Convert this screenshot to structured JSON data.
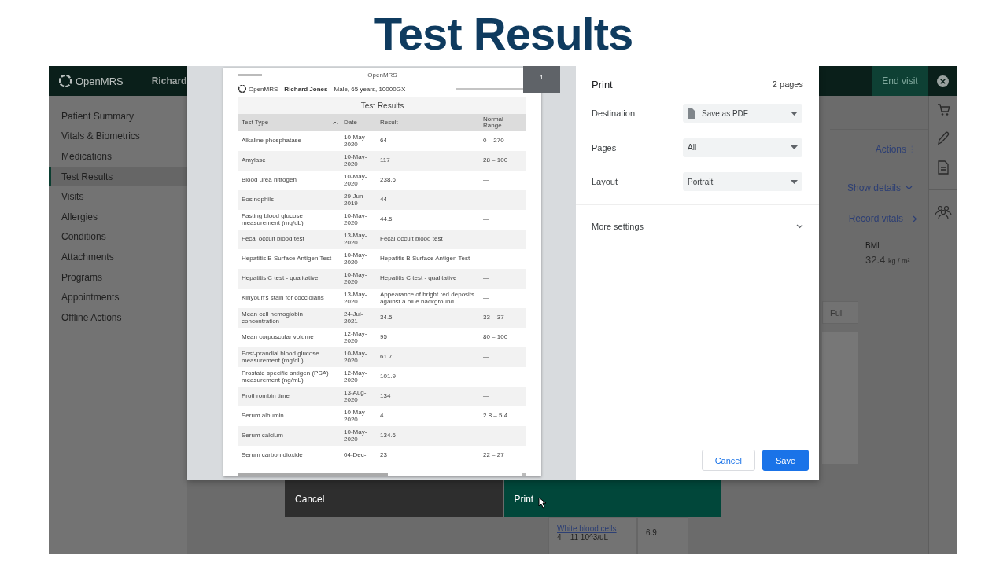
{
  "slide_title": "Test Results",
  "app": {
    "logo": "OpenMRS",
    "patient_name": "Richard",
    "end_visit": "End visit",
    "sidebar": {
      "items": [
        {
          "label": "Patient Summary",
          "selected": false
        },
        {
          "label": "Vitals & Biometrics",
          "selected": false
        },
        {
          "label": "Medications",
          "selected": false
        },
        {
          "label": "Test Results",
          "selected": true
        },
        {
          "label": "Visits",
          "selected": false
        },
        {
          "label": "Allergies",
          "selected": false
        },
        {
          "label": "Conditions",
          "selected": false
        },
        {
          "label": "Attachments",
          "selected": false
        },
        {
          "label": "Programs",
          "selected": false
        },
        {
          "label": "Appointments",
          "selected": false
        },
        {
          "label": "Offline Actions",
          "selected": false
        }
      ]
    },
    "actions": "Actions",
    "show_details": "Show details",
    "record_vitals": "Record vitals",
    "bmi": {
      "label": "BMI",
      "value": "32.4",
      "unit": "kg / m²"
    },
    "full_button": "Full",
    "result_row": {
      "test": "White blood cells",
      "range": "4 – 11 10^3/uL",
      "value": "6.9"
    },
    "modal_buttons": {
      "cancel": "Cancel",
      "print": "Print"
    }
  },
  "print_dialog": {
    "preview": {
      "page_badge": "1",
      "site": "OpenMRS",
      "logo": "OpenMRS",
      "patient_name": "Richard Jones",
      "patient_info": "Male, 65 years, 10000GX",
      "title": "Test Results",
      "columns": [
        "Test Type",
        "Date",
        "Result",
        "Normal Range"
      ],
      "rows": [
        {
          "test": "Alkaline phosphatase",
          "date": "10-May-2020",
          "result": "64",
          "range": "0 – 270"
        },
        {
          "test": "Amylase",
          "date": "10-May-2020",
          "result": "117",
          "range": "28 – 100"
        },
        {
          "test": "Blood urea nitrogen",
          "date": "10-May-2020",
          "result": "238.6",
          "range": "—"
        },
        {
          "test": "Eosinophils",
          "date": "29-Jun-2019",
          "result": "44",
          "range": "—"
        },
        {
          "test": "Fasting blood glucose measurement (mg/dL)",
          "date": "10-May-2020",
          "result": "44.5",
          "range": "—"
        },
        {
          "test": "Fecal occult blood test",
          "date": "13-May-2020",
          "result": "Fecal occult blood test"
        },
        {
          "test": "Hepatitis B Surface Antigen Test",
          "date": "10-May-2020",
          "result": "Hepatitis B Surface Antigen Test"
        },
        {
          "test": "Hepatitis C test - qualitative",
          "date": "10-May-2020",
          "result": "Hepatitis C test - qualitative",
          "range": "—"
        },
        {
          "test": "Kinyoun's stain for coccidians",
          "date": "13-May-2020",
          "result": "Appearance of bright red deposits against a blue background.",
          "range": "—"
        },
        {
          "test": "Mean cell hemoglobin concentration",
          "date": "24-Jul-2021",
          "result": "34.5",
          "range": "33 – 37"
        },
        {
          "test": "Mean corpuscular volume",
          "date": "12-May-2020",
          "result": "95",
          "range": "80 – 100"
        },
        {
          "test": "Post-prandial blood glucose measurement (mg/dL)",
          "date": "10-May-2020",
          "result": "61.7",
          "range": "—"
        },
        {
          "test": "Prostate specific antigen (PSA) measurement (ng/mL)",
          "date": "12-May-2020",
          "result": "101.9",
          "range": "—"
        },
        {
          "test": "Prothrombin time",
          "date": "13-Aug-2020",
          "result": "134",
          "range": "—"
        },
        {
          "test": "Serum albumin",
          "date": "10-May-2020",
          "result": "4",
          "range": "2.8 – 5.4"
        },
        {
          "test": "Serum calcium",
          "date": "10-May-2020",
          "result": "134.6",
          "range": "—"
        },
        {
          "test": "Serum carbon dioxide",
          "date": "04-Dec-",
          "result": "23",
          "range": "22 – 27"
        }
      ]
    },
    "title": "Print",
    "page_count": "2 pages",
    "settings": [
      {
        "label": "Destination",
        "value": "Save as PDF",
        "kind": "destination"
      },
      {
        "label": "Pages",
        "value": "All",
        "kind": "plain"
      },
      {
        "label": "Layout",
        "value": "Portrait",
        "kind": "plain"
      }
    ],
    "more_settings": "More settings",
    "buttons": {
      "cancel": "Cancel",
      "save": "Save"
    }
  }
}
